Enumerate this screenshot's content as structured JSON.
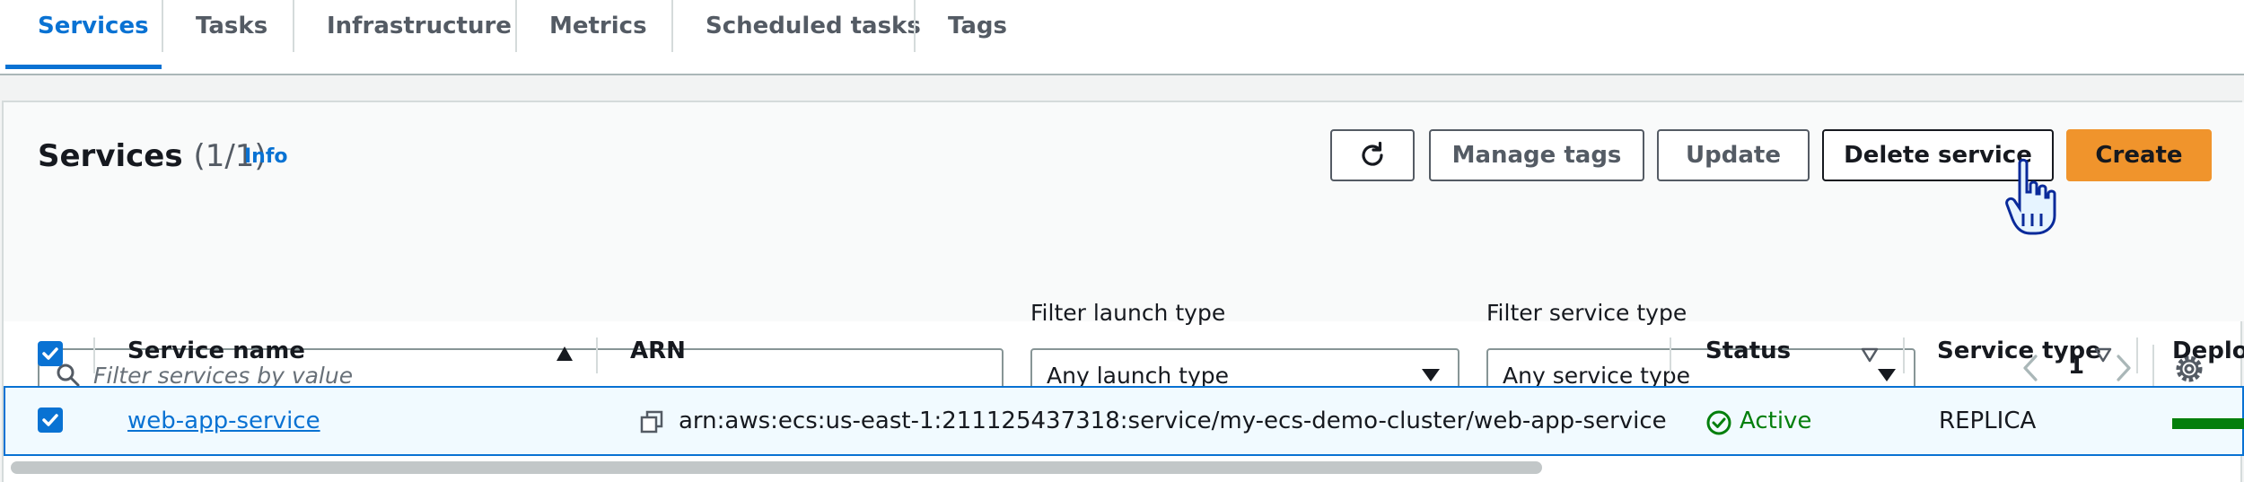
{
  "tabs": [
    {
      "label": "Services",
      "active": true
    },
    {
      "label": "Tasks"
    },
    {
      "label": "Infrastructure"
    },
    {
      "label": "Metrics"
    },
    {
      "label": "Scheduled tasks"
    },
    {
      "label": "Tags"
    }
  ],
  "services_panel": {
    "title": "Services",
    "count": "(1/1)",
    "info": "Info",
    "buttons": {
      "refresh_icon": "refresh-icon",
      "manage_tags": "Manage tags",
      "update": "Update",
      "delete_service": "Delete service",
      "create": "Create"
    },
    "search": {
      "placeholder": "Filter services by value"
    },
    "filters": {
      "launch_type_label": "Filter launch type",
      "launch_type_value": "Any launch type",
      "service_type_label": "Filter service type",
      "service_type_value": "Any service type"
    },
    "pagination": {
      "current_page": "1"
    },
    "columns": [
      "Service name",
      "ARN",
      "Status",
      "Service type",
      "Deploy"
    ],
    "rows": [
      {
        "service_name": "web-app-service",
        "arn": "arn:aws:ecs:us-east-1:211125437318:service/my-ecs-demo-cluster/web-app-service",
        "status": "Active",
        "service_type": "REPLICA"
      }
    ]
  },
  "colors": {
    "accent": "#0972d3",
    "primary_button": "#f0942c",
    "status_active": "#037f0c"
  }
}
